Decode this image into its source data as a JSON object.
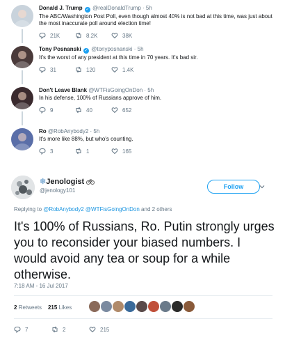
{
  "replies": [
    {
      "name": "Donald J. Trump",
      "verified": true,
      "handle": "@realDonaldTrump",
      "time": "· 5h",
      "text": "The ABC/Washington Post Poll, even though almost 40% is not bad at this time, was just about the most inaccurate poll around election time!",
      "replies": "21K",
      "retweets": "8.2K",
      "likes": "38K",
      "avatar_color": "#c9d3dc"
    },
    {
      "name": "Tony Posnanski",
      "verified": true,
      "handle": "@tonyposnanski",
      "time": "· 5h",
      "text": "It's the worst of any president at this time in 70 years. It's bad sir.",
      "replies": "31",
      "retweets": "120",
      "likes": "1.4K",
      "avatar_color": "#4a3a3a"
    },
    {
      "name": "Don't Leave Blank",
      "verified": false,
      "handle": "@WTFisGoingOnDon",
      "time": "· 5h",
      "text": "In his defense, 100% of Russians approve of him.",
      "replies": "9",
      "retweets": "40",
      "likes": "652",
      "avatar_color": "#3a2a2e"
    },
    {
      "name": "Ro",
      "verified": false,
      "handle": "@RobAnybody2",
      "time": "· 5h",
      "text": "It's more like 88%, but who's counting.",
      "replies": "3",
      "retweets": "1",
      "likes": "165",
      "avatar_color": "#5a6ea8"
    }
  ],
  "main": {
    "name_prefix": "❄",
    "name": "Jenologist",
    "handle": "@jenology101",
    "follow_label": "Follow",
    "replying_prefix": "Replying to",
    "replying_to_1": "@RobAnybody2",
    "replying_to_2": "@WTFisGoingOnDon",
    "replying_suffix": "and 2 others",
    "text": "It's 100% of Russians, Ro. Putin strongly urges you to reconsider your biased numbers. I would avoid any tea or soup for a while otherwise.",
    "timestamp": "7:18 AM - 16 Jul 2017",
    "retweets_count": "2",
    "retweets_label": "Retweets",
    "likes_count": "215",
    "likes_label": "Likes",
    "likers": [
      "#8a6a5a",
      "#7a8aa0",
      "#b08a6a",
      "#3a6a9a",
      "#5a4a4a",
      "#c0503a",
      "#6a7a8a",
      "#2a2a2a",
      "#8a5a3a"
    ],
    "actions": {
      "replies": "7",
      "retweets": "2",
      "likes": "215"
    }
  }
}
